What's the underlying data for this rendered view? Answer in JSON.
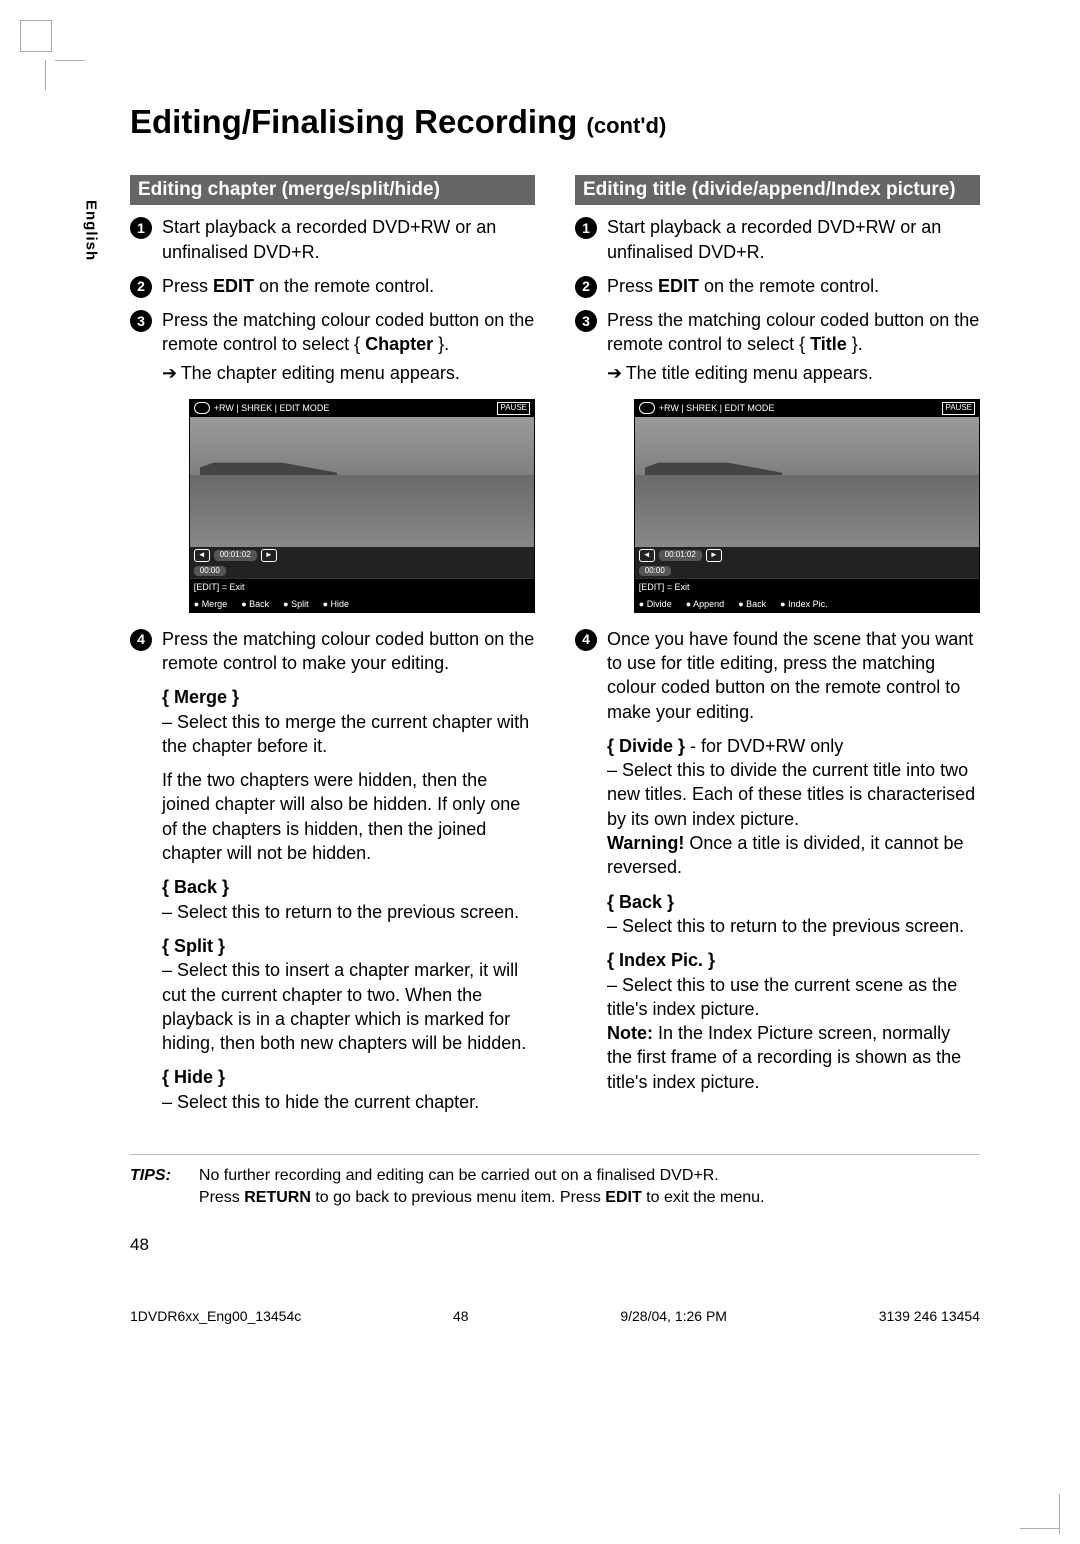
{
  "language_tab": "English",
  "page_title": "Editing/Finalising Recording",
  "page_title_suffix": "(cont'd)",
  "left": {
    "heading": "Editing chapter (merge/split/hide)",
    "step1": "Start playback a recorded DVD+RW or an unfinalised DVD+R.",
    "step2_pre": "Press ",
    "step2_bold": "EDIT",
    "step2_post": " on the remote control.",
    "step3_pre": "Press the matching colour coded button on the remote control to select { ",
    "step3_bold": "Chapter",
    "step3_post": " }.",
    "step3_result": "The chapter editing menu appears.",
    "menu": {
      "top_text": "+RW | SHREK | EDIT MODE",
      "pause_label": "PAUSE",
      "time_pill": "00:01:02",
      "small_time": "00:00",
      "exit_label": "[EDIT] = Exit",
      "opts": [
        "Merge",
        "Back",
        "Split",
        "Hide"
      ]
    },
    "step4": "Press the matching colour coded button on the remote control to make your editing.",
    "merge_label": "{ Merge }",
    "merge_text": "–  Select this to merge the current chapter with the chapter before it.",
    "merge_note": "If the two chapters were hidden, then the joined chapter will also be hidden.  If only one of the chapters is hidden, then the joined chapter will not be hidden.",
    "back_label": "{ Back }",
    "back_text": "–  Select this to return to the previous screen.",
    "split_label": "{ Split }",
    "split_text": "–  Select this to insert a chapter marker, it will cut the current chapter to two. When the playback is in a chapter which is marked for hiding, then both new chapters will be hidden.",
    "hide_label": "{ Hide }",
    "hide_text": "–  Select this to hide the current chapter."
  },
  "right": {
    "heading": "Editing title (divide/append/Index picture)",
    "step1": "Start playback a recorded DVD+RW or an unfinalised DVD+R.",
    "step2_pre": "Press ",
    "step2_bold": "EDIT",
    "step2_post": " on the remote control.",
    "step3_pre": "Press the matching colour coded button on the remote control to select { ",
    "step3_bold": "Title",
    "step3_post": " }.",
    "step3_result": "The title editing menu appears.",
    "menu": {
      "top_text": "+RW | SHREK | EDIT MODE",
      "pause_label": "PAUSE",
      "time_pill": "00:01:02",
      "small_time": "00:00",
      "exit_label": "[EDIT] = Exit",
      "opts": [
        "Divide",
        "Append",
        "Back",
        "Index Pic."
      ]
    },
    "step4": "Once you have found the scene that you want to use for title editing, press the matching colour coded button on the remote control to make your editing.",
    "divide_label": "{ Divide }",
    "divide_suffix": " - for DVD+RW only",
    "divide_text": "–  Select this to divide the current title into two new titles.  Each of these titles is characterised by its own index picture.",
    "divide_warn_b": "Warning!",
    "divide_warn_t": " Once a title is divided, it cannot be reversed.",
    "back_label": "{ Back }",
    "back_text": "–  Select this to return to the previous screen.",
    "idx_label": "{ Index Pic. }",
    "idx_text": "–  Select this to use the current scene as the title's index picture.",
    "idx_note_b": "Note:",
    "idx_note_t": "  In the Index Picture screen, normally the first frame of a recording is shown as the title's index picture."
  },
  "tips": {
    "label": "TIPS:",
    "line1_a": "No further recording and editing can be carried out on a finalised DVD+R.",
    "line2_a": "Press ",
    "line2_b1": "RETURN",
    "line2_c": " to go back to previous menu item.  Press ",
    "line2_b2": "EDIT",
    "line2_d": " to exit the menu."
  },
  "page_number": "48",
  "footer": {
    "file": "1DVDR6xx_Eng00_13454c",
    "midnum": "48",
    "datetime": "9/28/04, 1:26 PM",
    "docnum": "3139 246 13454"
  }
}
